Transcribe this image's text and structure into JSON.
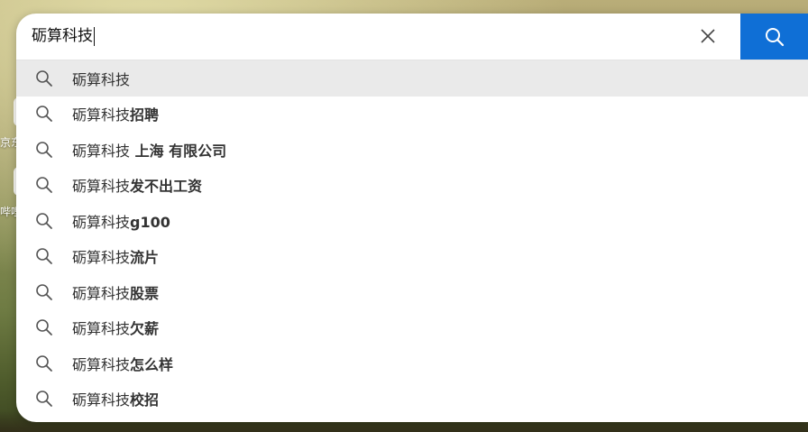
{
  "search": {
    "query": "砺算科技",
    "clear_icon": "close-icon",
    "submit_icon": "search-icon",
    "accent_color": "#0f6fd6"
  },
  "suggestions": [
    {
      "prefix": "砺算科技",
      "suffix": ""
    },
    {
      "prefix": "砺算科技",
      "suffix": "招聘"
    },
    {
      "prefix": "砺算科技",
      "suffix": " 上海 有限公司"
    },
    {
      "prefix": "砺算科技",
      "suffix": "发不出工资"
    },
    {
      "prefix": "砺算科技",
      "suffix": "g100"
    },
    {
      "prefix": "砺算科技",
      "suffix": "流片"
    },
    {
      "prefix": "砺算科技",
      "suffix": "股票"
    },
    {
      "prefix": "砺算科技",
      "suffix": "欠薪"
    },
    {
      "prefix": "砺算科技",
      "suffix": "怎么样"
    },
    {
      "prefix": "砺算科技",
      "suffix": "校招"
    }
  ],
  "background_tiles": [
    {
      "label": "京东"
    },
    {
      "label": "哔哩"
    }
  ]
}
